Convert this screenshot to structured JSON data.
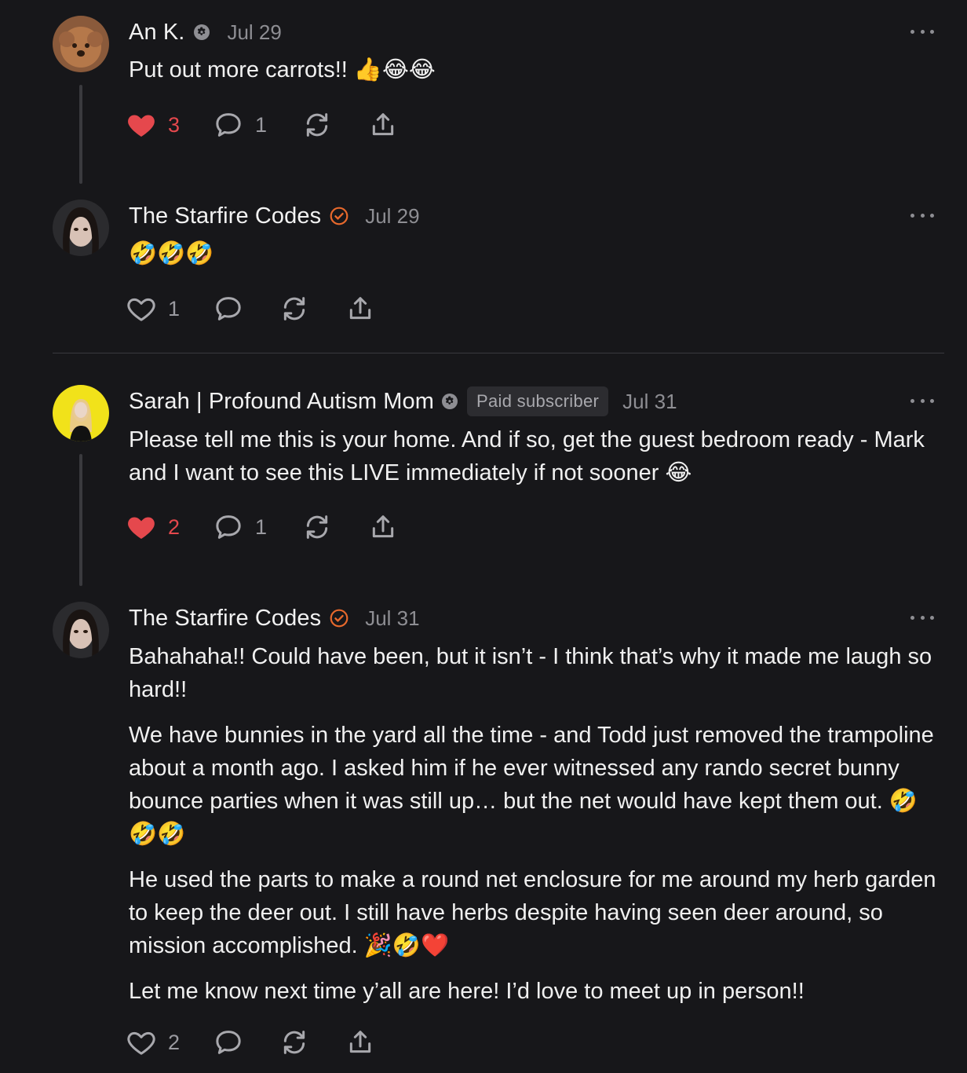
{
  "colors": {
    "background": "#17171a",
    "heart_liked": "#e5484d",
    "verified": "#e8692c",
    "muted": "#8e8e93"
  },
  "comments": [
    {
      "author": "An K.",
      "date": "Jul 29",
      "badge": "subscriber-icon",
      "text": [
        "Put out more carrots!! 👍😂😂"
      ],
      "likes": "3",
      "liked": true,
      "replies": "1"
    },
    {
      "author": "The Starfire Codes",
      "date": "Jul 29",
      "badge": "verified-check-icon",
      "text": [
        "🤣🤣🤣"
      ],
      "likes": "1",
      "liked": false,
      "replies": ""
    },
    {
      "author": "Sarah | Profound Autism Mom",
      "date": "Jul 31",
      "badge": "subscriber-icon",
      "paid_label": "Paid subscriber",
      "text": [
        "Please tell me this is your home. And if so, get the guest bedroom ready - Mark and I want to see this LIVE immediately if not sooner 😂"
      ],
      "likes": "2",
      "liked": true,
      "replies": "1"
    },
    {
      "author": "The Starfire Codes",
      "date": "Jul 31",
      "badge": "verified-check-icon",
      "text": [
        "Bahahaha!! Could have been, but it isn’t - I think that’s why it made me laugh so hard!!",
        "We have bunnies in the yard all the time - and Todd just removed the trampoline about a month ago. I asked him if he ever witnessed any rando secret bunny bounce parties when it was still up… but the net would have kept them out. 🤣🤣🤣",
        "He used the parts to make a round net enclosure for me around my herb garden to keep the deer out. I still have herbs despite having seen deer around, so mission accomplished. 🎉🤣❤️",
        "Let me know next time y’all are here! I’d love to meet up in person!!"
      ],
      "likes": "2",
      "liked": false,
      "replies": ""
    }
  ]
}
